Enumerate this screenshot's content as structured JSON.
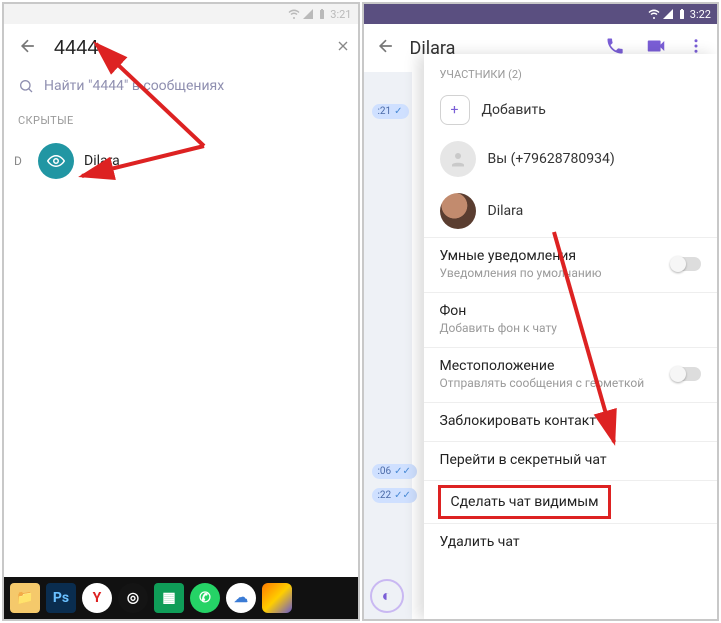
{
  "left": {
    "status_time": "3:21",
    "search_value": "4444",
    "search_hint": "Найти \"4444\" в сообщениях",
    "section_hidden": "СКРЫТЫЕ",
    "letter": "D",
    "result_name": "Dilara",
    "taskbar_icons": [
      "folder",
      "photoshop",
      "yandex",
      "target",
      "sheets",
      "whatsapp",
      "edge",
      "home"
    ]
  },
  "right": {
    "status_time": "3:22",
    "title": "Dilara",
    "participants_label": "УЧАСТНИКИ (2)",
    "add_label": "Добавить",
    "you_label": "Вы (+79628780934)",
    "dilara_label": "Dilara",
    "smart_notif_title": "Умные уведомления",
    "smart_notif_sub": "Уведомления по умолчанию",
    "bg_title": "Фон",
    "bg_sub": "Добавить фон к чату",
    "loc_title": "Местоположение",
    "loc_sub": "Отправлять сообщения с геометкой",
    "block_label": "Заблокировать контакт",
    "secret_label": "Перейти в секретный чат",
    "make_visible_label": "Сделать чат видимым",
    "delete_label": "Удалить чат",
    "time1": ":21",
    "time2": ":06",
    "time3": ":22"
  }
}
